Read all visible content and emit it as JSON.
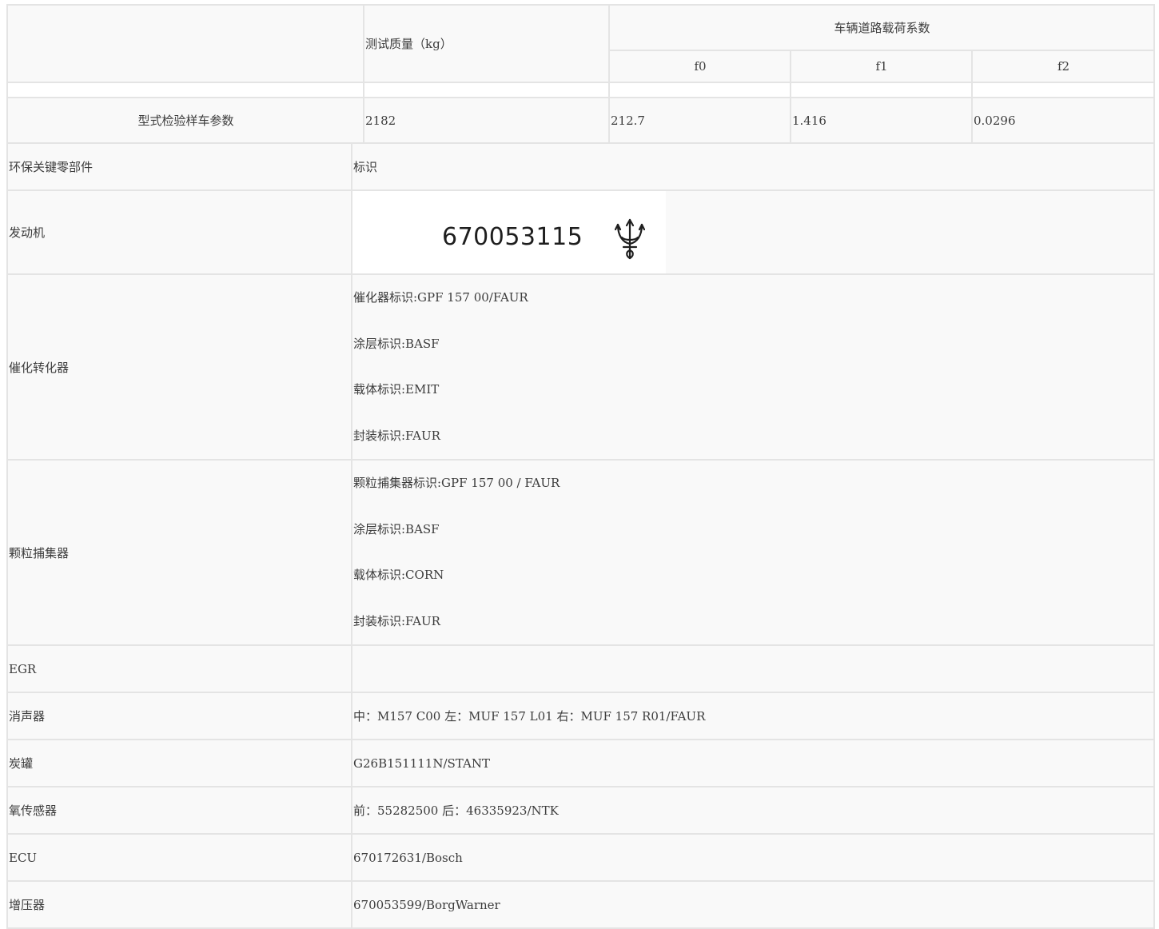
{
  "vehicle_params": {
    "row_label": "型式检验样车参数",
    "test_mass_header": "测试质量（kg）",
    "road_load_header": "车辆道路载荷系数",
    "coefficients": [
      "f0",
      "f1",
      "f2"
    ],
    "test_mass": "2182",
    "values": [
      "212.7",
      "1.416",
      "0.0296"
    ]
  },
  "components": {
    "header": {
      "part": "环保关键零部件",
      "id": "标识"
    },
    "engine": {
      "label": "发动机",
      "stamp_number": "670053115",
      "stamp_logo": "trident-logo"
    },
    "catalyst": {
      "label": "催化转化器",
      "lines": [
        "催化器标识:GPF 157 00/FAUR",
        "涂层标识:BASF",
        "载体标识:EMIT",
        "封装标识:FAUR"
      ]
    },
    "gpf": {
      "label": "颗粒捕集器",
      "lines": [
        "颗粒捕集器标识:GPF 157 00 / FAUR",
        "涂层标识:BASF",
        "载体标识:CORN",
        "封装标识:FAUR"
      ]
    },
    "rows": [
      {
        "label": "EGR",
        "value": ""
      },
      {
        "label": "消声器",
        "value": "中：M157 C00 左：MUF 157 L01 右：MUF 157 R01/FAUR"
      },
      {
        "label": "炭罐",
        "value": "G26B151111N/STANT"
      },
      {
        "label": "氧传感器",
        "value": "前：55282500 后：46335923/NTK"
      },
      {
        "label": "ECU",
        "value": "670172631/Bosch"
      },
      {
        "label": "增压器",
        "value": "670053599/BorgWarner"
      }
    ]
  }
}
